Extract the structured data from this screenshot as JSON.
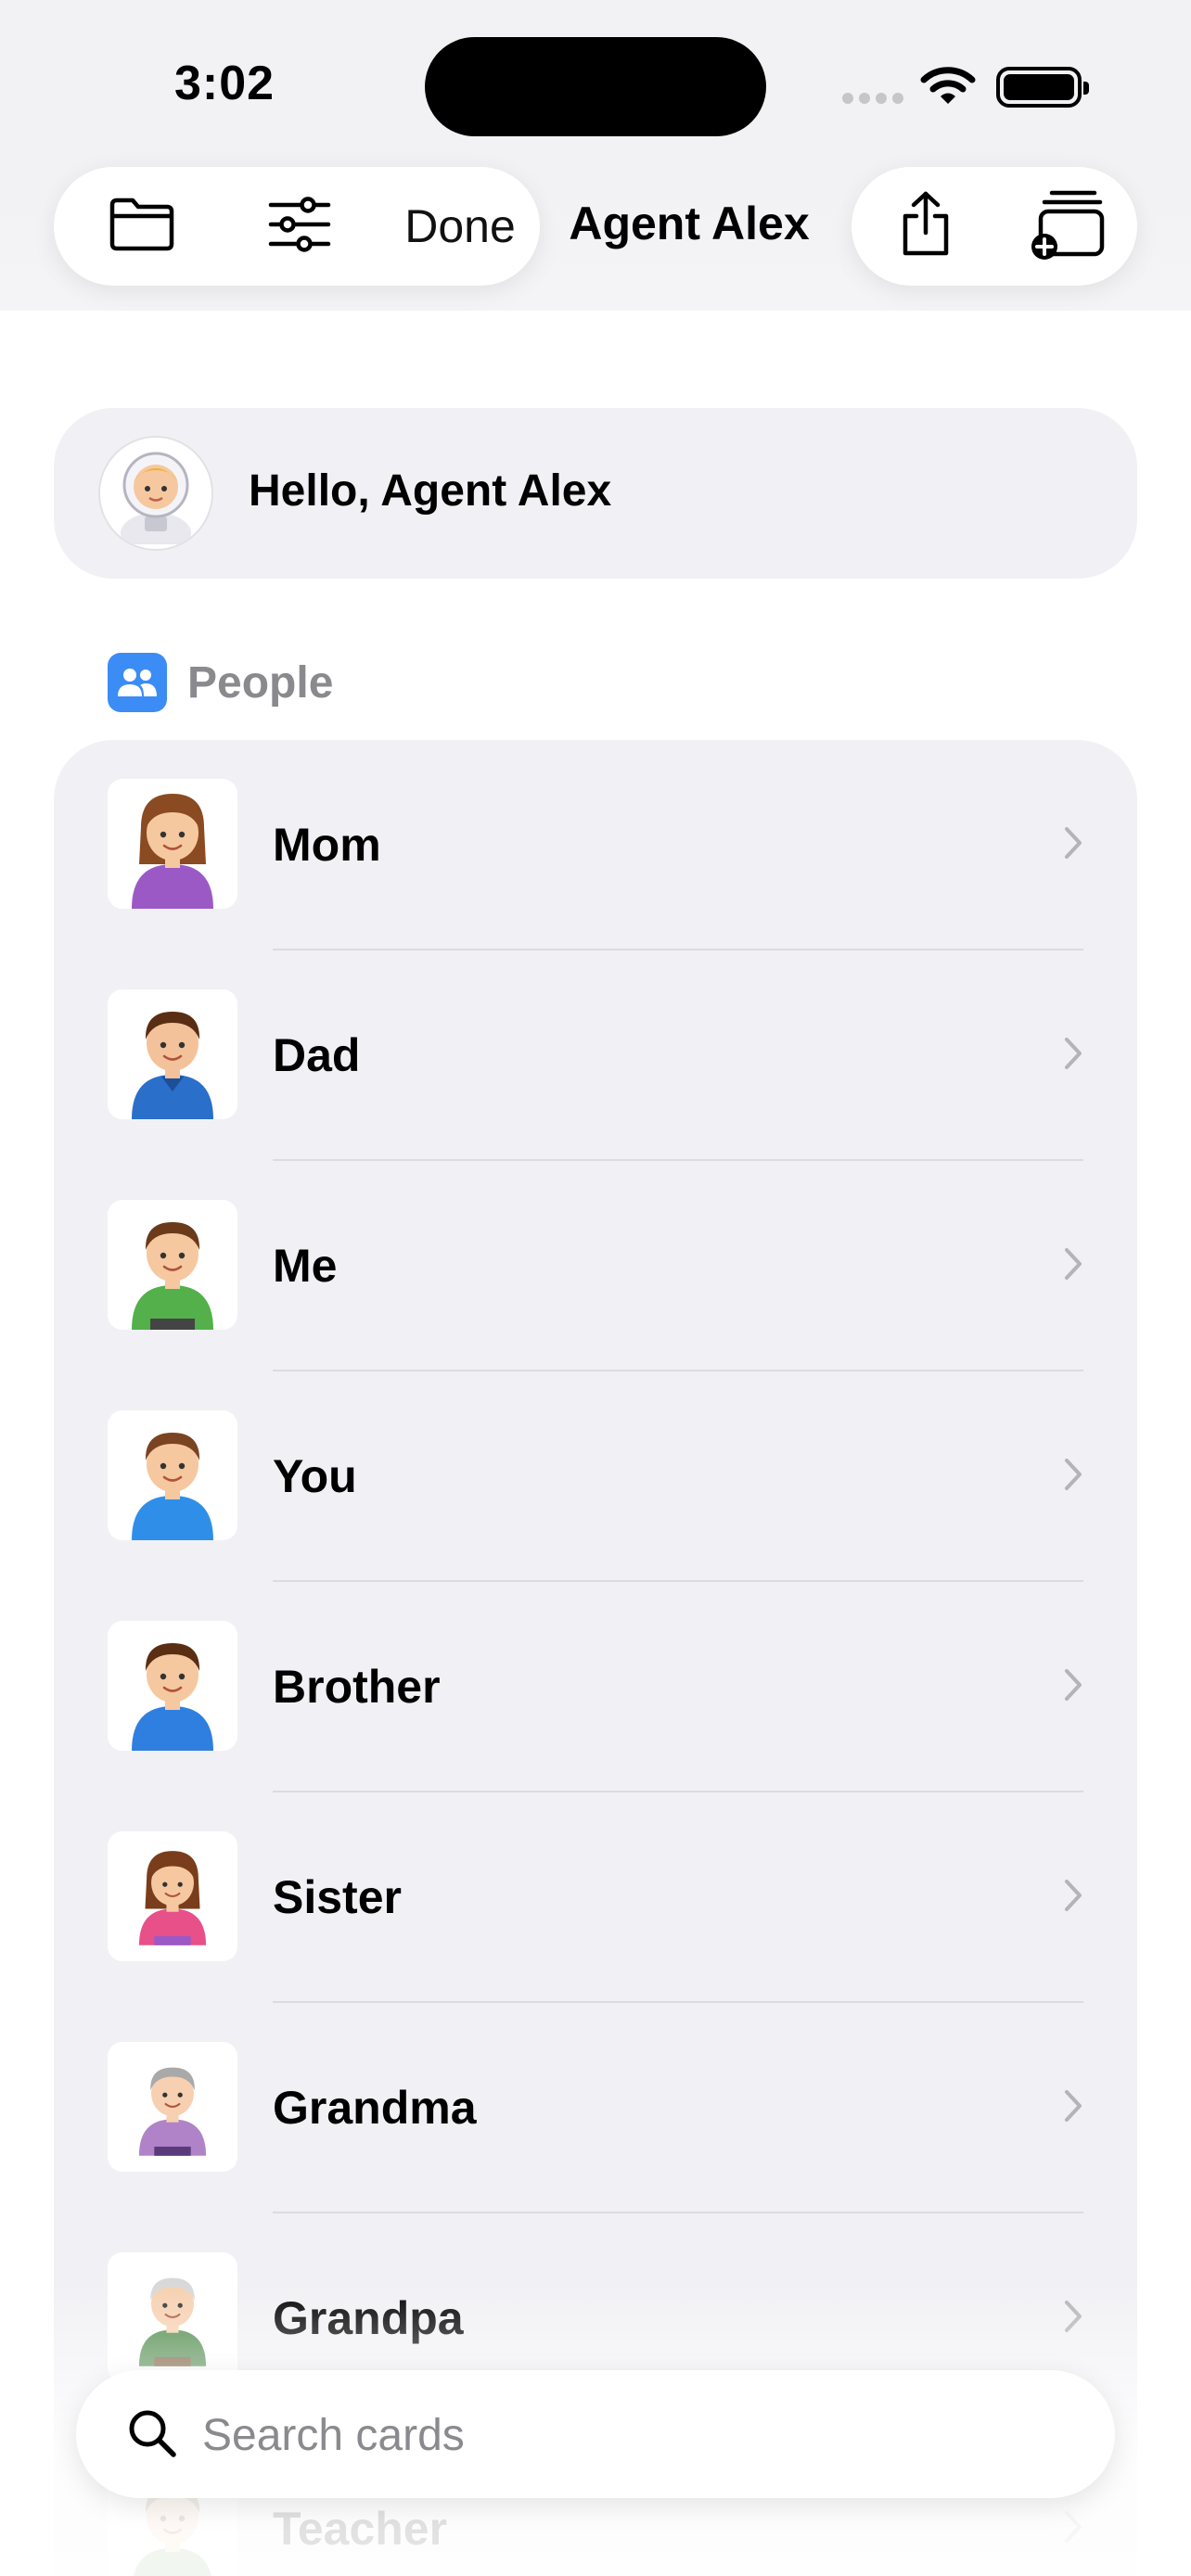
{
  "status_bar": {
    "time": "3:02"
  },
  "toolbar": {
    "folder_icon": "folder-icon",
    "filter_icon": "sliders-icon",
    "done_label": "Done",
    "title": "Agent Alex",
    "share_icon": "share-icon",
    "add_card_icon": "add-card-stack-icon"
  },
  "greeting": {
    "avatar": "astronaut",
    "text": "Hello, Agent Alex"
  },
  "section": {
    "icon": "people-icon",
    "label": "People",
    "accent": "#3b8cf5"
  },
  "cards": [
    {
      "label": "Mom",
      "image": "mom"
    },
    {
      "label": "Dad",
      "image": "dad"
    },
    {
      "label": "Me",
      "image": "me"
    },
    {
      "label": "You",
      "image": "you"
    },
    {
      "label": "Brother",
      "image": "brother"
    },
    {
      "label": "Sister",
      "image": "sister"
    },
    {
      "label": "Grandma",
      "image": "grandma"
    },
    {
      "label": "Grandpa",
      "image": "grandpa"
    },
    {
      "label": "Teacher",
      "image": "teacher"
    }
  ],
  "search": {
    "placeholder": "Search cards"
  }
}
